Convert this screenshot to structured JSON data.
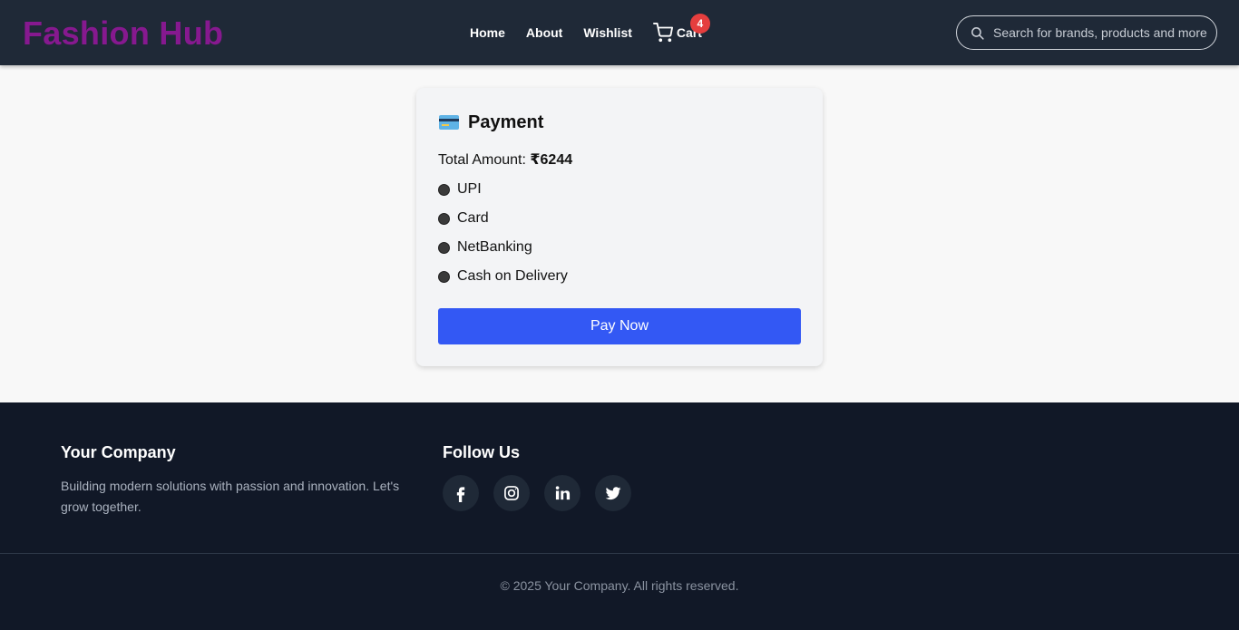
{
  "header": {
    "logo": "Fashion Hub",
    "nav": [
      "Home",
      "About",
      "Wishlist"
    ],
    "cart_label": "Cart",
    "cart_count": "4",
    "search_placeholder": "Search for brands, products and more"
  },
  "payment": {
    "title": "Payment",
    "total_label": "Total Amount: ",
    "total_value": "₹6244",
    "options": [
      "UPI",
      "Card",
      "NetBanking",
      "Cash on Delivery"
    ],
    "pay_button": "Pay Now"
  },
  "footer": {
    "company_title": "Your Company",
    "company_desc": "Building modern solutions with passion and innovation. Let's grow together.",
    "follow_title": "Follow Us",
    "socials": [
      "facebook-icon",
      "instagram-icon",
      "linkedin-icon",
      "twitter-icon"
    ],
    "copyright": "© 2025 Your Company. All rights reserved."
  },
  "colors": {
    "header_bg": "#1f2937",
    "logo": "#86198f",
    "accent_button": "#3358f4",
    "badge": "#e53e3e",
    "footer_bg": "#111827"
  }
}
